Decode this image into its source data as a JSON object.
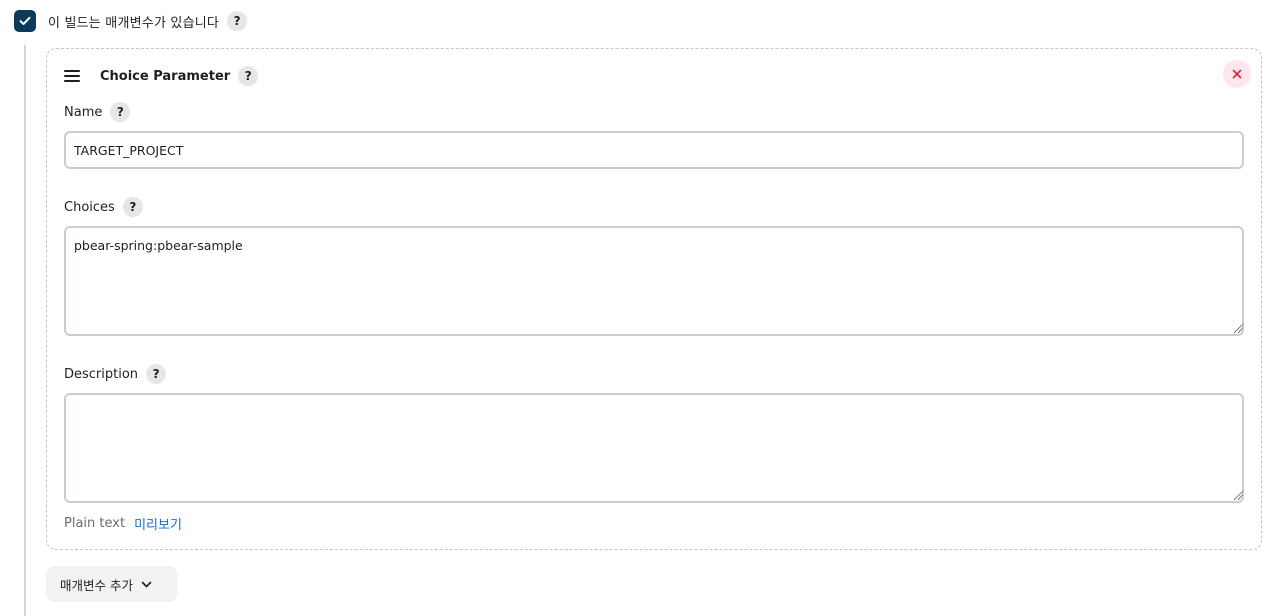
{
  "params_toggle": {
    "checked": true,
    "label": "이 빌드는 매개변수가 있습니다",
    "help": "?"
  },
  "parameter_card": {
    "title": "Choice Parameter",
    "help": "?",
    "fields": {
      "name": {
        "label": "Name",
        "help": "?",
        "value": "TARGET_PROJECT"
      },
      "choices": {
        "label": "Choices",
        "help": "?",
        "value": "pbear-spring:pbear-sample"
      },
      "description": {
        "label": "Description",
        "help": "?",
        "value": ""
      }
    },
    "footnote": {
      "format": "Plain text",
      "preview_link": "미리보기"
    }
  },
  "add_parameter_button": {
    "label": "매개변수 추가"
  },
  "colors": {
    "checkbox": "#0c3a5b",
    "link": "#1a6fbf",
    "close_accent": "#e0243d"
  }
}
